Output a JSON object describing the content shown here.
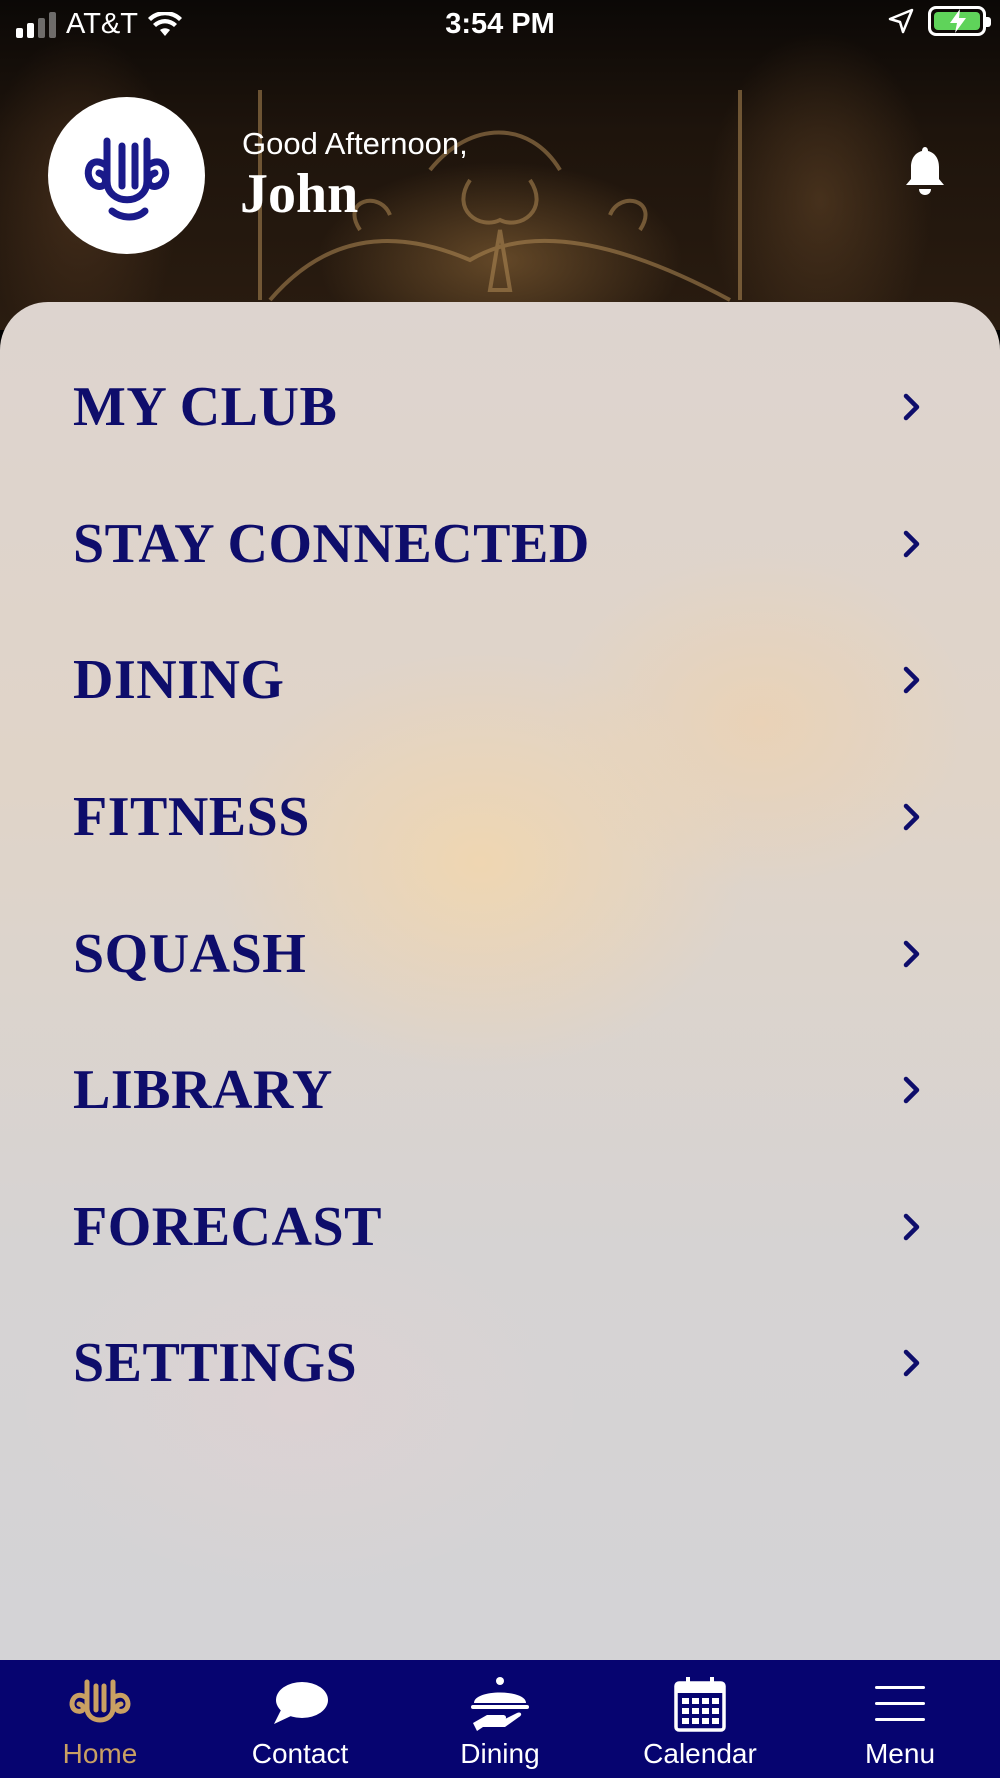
{
  "status_bar": {
    "carrier": "AT&T",
    "time": "3:54 PM"
  },
  "header": {
    "greeting": "Good Afternoon,",
    "user_name": "John"
  },
  "menu": {
    "items": [
      {
        "label": "MY CLUB"
      },
      {
        "label": "STAY CONNECTED"
      },
      {
        "label": "DINING"
      },
      {
        "label": "FITNESS"
      },
      {
        "label": "SQUASH"
      },
      {
        "label": "LIBRARY"
      },
      {
        "label": "FORECAST"
      },
      {
        "label": "SETTINGS"
      }
    ]
  },
  "tab_bar": {
    "tabs": [
      {
        "label": "Home",
        "icon": "club-logo-icon",
        "active": true
      },
      {
        "label": "Contact",
        "icon": "chat-bubble-icon",
        "active": false
      },
      {
        "label": "Dining",
        "icon": "serving-cloche-icon",
        "active": false
      },
      {
        "label": "Calendar",
        "icon": "calendar-icon",
        "active": false
      },
      {
        "label": "Menu",
        "icon": "hamburger-menu-icon",
        "active": false
      }
    ]
  },
  "colors": {
    "brand_navy": "#060470",
    "menu_text": "#0e0d6b",
    "active_tab": "#c9a063",
    "battery_green": "#5fd35a"
  }
}
